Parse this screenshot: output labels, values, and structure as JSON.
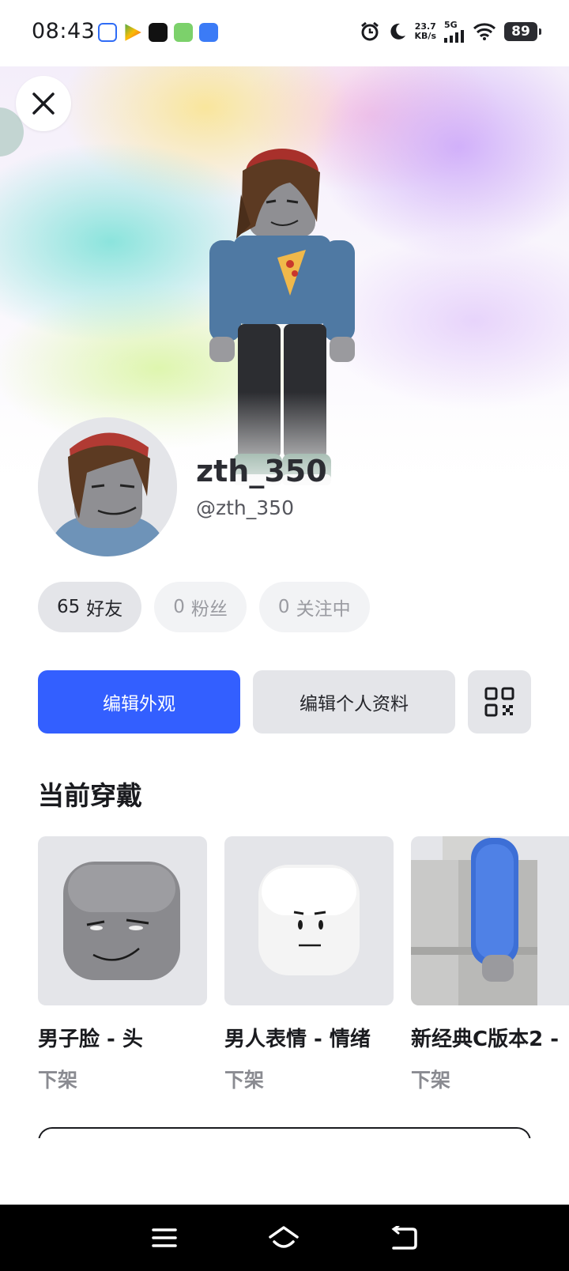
{
  "status_bar": {
    "time": "08:43",
    "net_speed_value": "23.7",
    "net_speed_unit": "KB/s",
    "network_type": "5G",
    "battery": "89"
  },
  "profile": {
    "display_name": "zth_350",
    "username": "@zth_350"
  },
  "stats": [
    {
      "count": "65",
      "label": "好友"
    },
    {
      "count": "0",
      "label": "粉丝"
    },
    {
      "count": "0",
      "label": "关注中"
    }
  ],
  "actions": {
    "edit_avatar": "编辑外观",
    "edit_profile": "编辑个人资料"
  },
  "currently_wearing": {
    "title": "当前穿戴",
    "items": [
      {
        "name": "男子脸 - 头",
        "status": "下架"
      },
      {
        "name": "男人表情 - 情绪",
        "status": "下架"
      },
      {
        "name": "新经典C版本2 -",
        "status": "下架"
      }
    ]
  },
  "colors": {
    "primary": "#335fff",
    "secondary_bg": "#e4e5e9",
    "text": "#1a1b1f"
  },
  "icons": {
    "close": "close-icon",
    "qr": "qr-code-icon",
    "nav_menu": "menu-icon",
    "nav_home": "home-icon",
    "nav_back": "back-icon"
  }
}
